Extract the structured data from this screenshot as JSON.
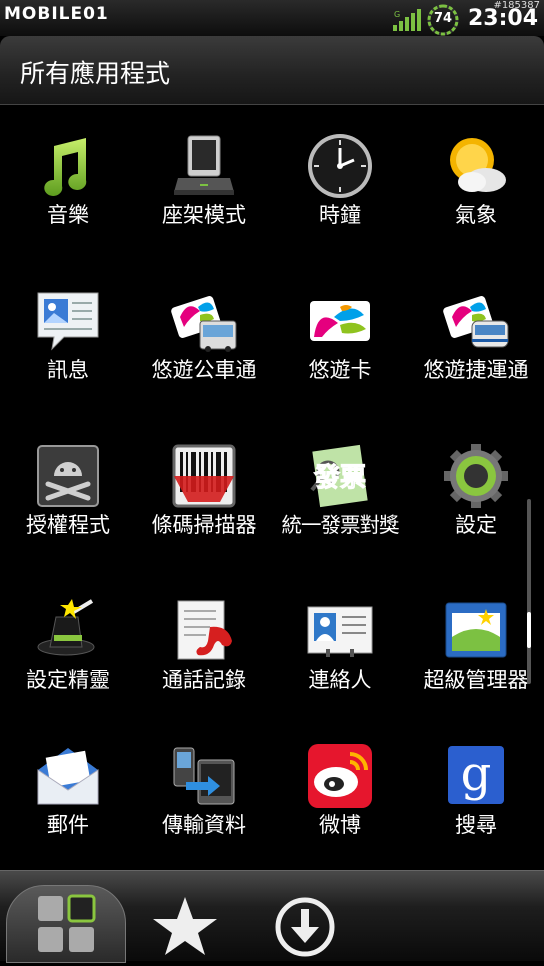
{
  "status_bar": {
    "logo": "MOBILE01",
    "battery_level": "74",
    "time": "23:04",
    "watermark": "#185387"
  },
  "title": "所有應用程式",
  "apps": [
    {
      "label": "音樂",
      "icon": "music-note-icon"
    },
    {
      "label": "座架模式",
      "icon": "dock-mode-icon"
    },
    {
      "label": "時鐘",
      "icon": "clock-icon"
    },
    {
      "label": "氣象",
      "icon": "weather-icon"
    },
    {
      "label": "訊息",
      "icon": "messages-icon"
    },
    {
      "label": "悠遊公車通",
      "icon": "easycard-bus-icon"
    },
    {
      "label": "悠遊卡",
      "icon": "easycard-icon"
    },
    {
      "label": "悠遊捷運通",
      "icon": "easycard-metro-icon"
    },
    {
      "label": "授權程式",
      "icon": "android-license-icon"
    },
    {
      "label": "條碼掃描器",
      "icon": "barcode-scanner-icon"
    },
    {
      "label": "統一發票對獎",
      "icon": "invoice-lottery-icon",
      "icon_text": "發票"
    },
    {
      "label": "設定",
      "icon": "settings-gear-icon"
    },
    {
      "label": "設定精靈",
      "icon": "setup-wizard-icon"
    },
    {
      "label": "通話記錄",
      "icon": "call-log-icon"
    },
    {
      "label": "連絡人",
      "icon": "contacts-icon"
    },
    {
      "label": "超級管理器",
      "icon": "super-manager-icon"
    },
    {
      "label": "郵件",
      "icon": "mail-icon"
    },
    {
      "label": "傳輸資料",
      "icon": "transfer-data-icon"
    },
    {
      "label": "微博",
      "icon": "weibo-icon"
    },
    {
      "label": "搜尋",
      "icon": "google-search-icon",
      "icon_text": "g"
    }
  ],
  "bottom_bar": {
    "items": [
      "all-apps-icon",
      "star-icon",
      "download-icon"
    ]
  },
  "colors": {
    "background": "#000000",
    "accent_green": "#8ac63f",
    "text": "#ffffff"
  }
}
